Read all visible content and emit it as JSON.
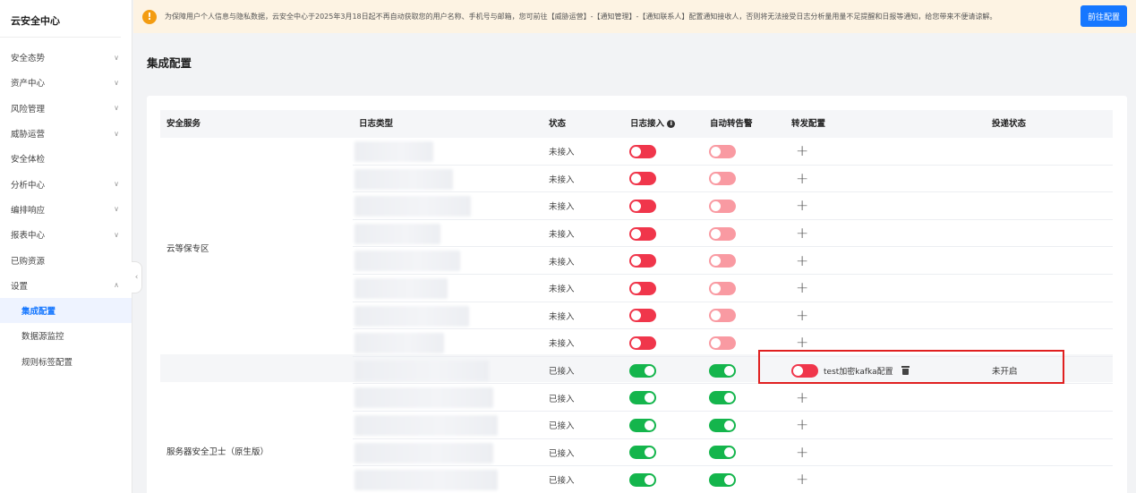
{
  "sidebar": {
    "title": "云安全中心",
    "items": [
      {
        "label": "安全态势",
        "expandable": true
      },
      {
        "label": "资产中心",
        "expandable": true
      },
      {
        "label": "风险管理",
        "expandable": true
      },
      {
        "label": "威胁运营",
        "expandable": true
      },
      {
        "label": "安全体检",
        "expandable": false
      },
      {
        "label": "分析中心",
        "expandable": true
      },
      {
        "label": "编排响应",
        "expandable": true
      },
      {
        "label": "报表中心",
        "expandable": true
      },
      {
        "label": "已购资源",
        "expandable": false
      },
      {
        "label": "设置",
        "expandable": true,
        "expanded": true
      }
    ],
    "sub_items": [
      {
        "label": "集成配置",
        "active": true
      },
      {
        "label": "数据源监控",
        "active": false
      },
      {
        "label": "规则标签配置",
        "active": false
      }
    ]
  },
  "notice": {
    "text": "为保障用户个人信息与隐私数据，云安全中心于2025年3月18日起不再自动获取您的用户名称、手机号与邮箱，您可前往【威胁运营】-【通知管理】-【通知联系人】配置通知接收人，否则将无法接受日志分析量用量不足提醒和日报等通知，给您带来不便请谅解。",
    "button_label": "前往配置"
  },
  "page_title": "集成配置",
  "table": {
    "headers": {
      "service": "安全服务",
      "log_type": "日志类型",
      "status": "状态",
      "log_access": "日志接入",
      "auto_alert": "自动转告警",
      "forward_config": "转发配置",
      "delivery_status": "投递状态"
    },
    "groups": [
      {
        "service": "云等保专区",
        "rows": [
          {
            "status": "未接入",
            "log_access": false,
            "auto_alert": false
          },
          {
            "status": "未接入",
            "log_access": false,
            "auto_alert": false
          },
          {
            "status": "未接入",
            "log_access": false,
            "auto_alert": false
          },
          {
            "status": "未接入",
            "log_access": false,
            "auto_alert": false
          },
          {
            "status": "未接入",
            "log_access": false,
            "auto_alert": false
          },
          {
            "status": "未接入",
            "log_access": false,
            "auto_alert": false
          },
          {
            "status": "未接入",
            "log_access": false,
            "auto_alert": false
          },
          {
            "status": "未接入",
            "log_access": false,
            "auto_alert": false
          }
        ]
      },
      {
        "service": "服务器安全卫士（原生版）",
        "rows": [
          {
            "status": "已接入",
            "log_access": true,
            "auto_alert": true,
            "forward": {
              "name": "test加密kafka配置",
              "enabled": false
            },
            "delivery_status": "未开启"
          },
          {
            "status": "已接入",
            "log_access": true,
            "auto_alert": true
          },
          {
            "status": "已接入",
            "log_access": true,
            "auto_alert": true
          },
          {
            "status": "已接入",
            "log_access": true,
            "auto_alert": true
          },
          {
            "status": "已接入",
            "log_access": true,
            "auto_alert": true
          }
        ]
      }
    ]
  },
  "colors": {
    "primary": "#1677ff",
    "toggle_off": "#f0364b",
    "toggle_off_disabled": "#f99aa2",
    "toggle_on": "#14b54c",
    "highlight": "#e02020",
    "notice_bg": "#fdf3e3",
    "warning": "#f39c12"
  }
}
